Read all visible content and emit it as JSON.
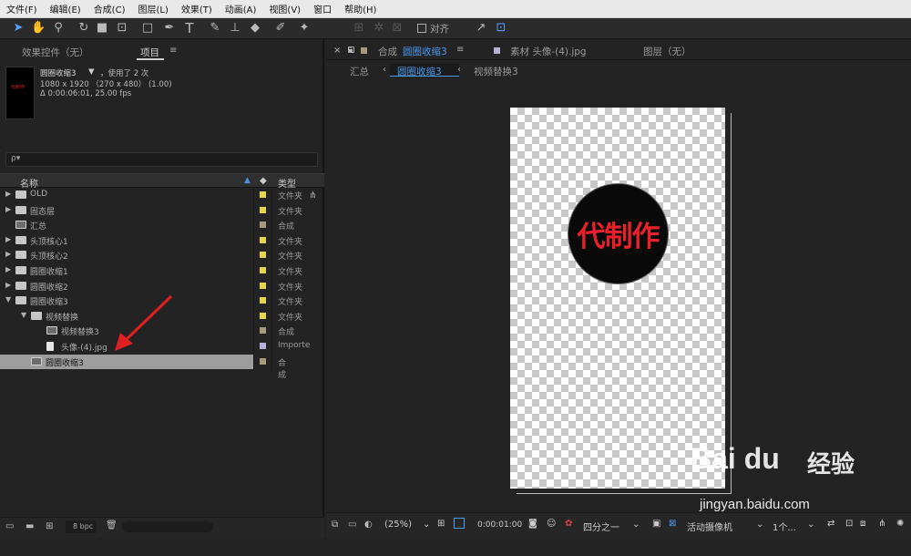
{
  "menu": [
    "文件(F)",
    "编辑(E)",
    "合成(C)",
    "图层(L)",
    "效果(T)",
    "动画(A)",
    "视图(V)",
    "窗口",
    "帮助(H)"
  ],
  "toolbar": {
    "align_label": "对齐"
  },
  "left_tabs": {
    "effects": "效果控件（无）",
    "project": "项目"
  },
  "project_info": {
    "name": "圆圈收缩3",
    "usage": "，使用了 2 次",
    "dims": "1080 x 1920 （270 x 480） (1.00)",
    "duration": "Δ 0:00:06:01, 25.00 fps",
    "thumb_text": "代制作"
  },
  "search": {
    "placeholder": "ρ▾"
  },
  "columns": {
    "name": "名称",
    "type": "类型"
  },
  "rows": [
    {
      "label": "OLD",
      "type": "文件夹",
      "kind": "folder",
      "indent": 0,
      "expanded": false,
      "color": "#e8d44c"
    },
    {
      "label": "固态层",
      "type": "文件夹",
      "kind": "folder",
      "indent": 0,
      "expanded": false,
      "color": "#e8d44c"
    },
    {
      "label": "汇总",
      "type": "合成",
      "kind": "comp",
      "indent": 0,
      "expanded": null,
      "color": "#a89a7a"
    },
    {
      "label": "头顶核心1",
      "type": "文件夹",
      "kind": "folder",
      "indent": 0,
      "expanded": false,
      "color": "#e8d44c"
    },
    {
      "label": "头顶核心2",
      "type": "文件夹",
      "kind": "folder",
      "indent": 0,
      "expanded": false,
      "color": "#e8d44c"
    },
    {
      "label": "圆圈收缩1",
      "type": "文件夹",
      "kind": "folder",
      "indent": 0,
      "expanded": false,
      "color": "#e8d44c"
    },
    {
      "label": "圆圈收缩2",
      "type": "文件夹",
      "kind": "folder",
      "indent": 0,
      "expanded": false,
      "color": "#e8d44c"
    },
    {
      "label": "圆圈收缩3",
      "type": "文件夹",
      "kind": "folder",
      "indent": 0,
      "expanded": true,
      "color": "#e8d44c"
    },
    {
      "label": "视频替换",
      "type": "文件夹",
      "kind": "folder",
      "indent": 1,
      "expanded": true,
      "color": "#e8d44c"
    },
    {
      "label": "视频替换3",
      "type": "合成",
      "kind": "comp",
      "indent": 2,
      "expanded": null,
      "color": "#a89a7a"
    },
    {
      "label": "头像-(4).jpg",
      "type": "Importe",
      "kind": "file",
      "indent": 2,
      "expanded": null,
      "color": "#b8b0d8"
    },
    {
      "label": "圆圈收缩3",
      "type": "合成",
      "kind": "comp",
      "indent": 1,
      "expanded": null,
      "color": "#a89a7a",
      "selected": true
    }
  ],
  "left_bottom": {
    "bpc": "8 bpc"
  },
  "right_tabs": {
    "comp_prefix": "合成",
    "comp_name": "圆圈收缩3",
    "footage": "素材 头像-(4).jpg",
    "layer": "图层（无）"
  },
  "breadcrumb": {
    "a": "汇总",
    "b": "圆圈收缩3",
    "c": "视频替换3"
  },
  "canvas": {
    "text": "代制作"
  },
  "viewer_bar": {
    "zoom": "(25%)",
    "timecode": "0:00:01:00",
    "resolution": "四分之一",
    "camera": "活动摄像机",
    "views": "1个..."
  },
  "watermark": {
    "brand": "Bai du",
    "cn": "经验",
    "url": "jingyan.baidu.com"
  }
}
